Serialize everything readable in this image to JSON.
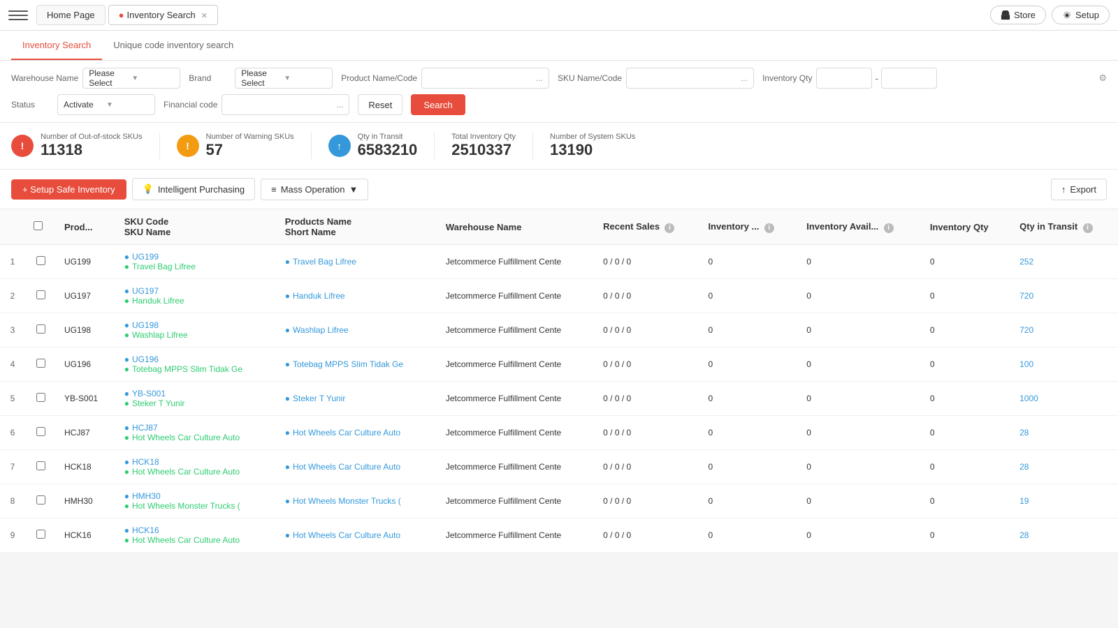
{
  "topNav": {
    "homeTab": "Home Page",
    "inventoryTab": "Inventory Search",
    "storeBtn": "Store",
    "setupBtn": "Setup"
  },
  "pageTabs": [
    {
      "id": "inventory-search",
      "label": "Inventory Search",
      "active": true
    },
    {
      "id": "unique-code",
      "label": "Unique code inventory search",
      "active": false
    }
  ],
  "filters": {
    "warehouseLabel": "Warehouse Name",
    "warehousePlaceholder": "Please Select",
    "brandLabel": "Brand",
    "brandPlaceholder": "Please Select",
    "productNameLabel": "Product Name/Code",
    "skuLabel": "SKU Name/Code",
    "inventoryQtyLabel": "Inventory Qty",
    "statusLabel": "Status",
    "statusValue": "Activate",
    "financialCodeLabel": "Financial code",
    "resetBtn": "Reset",
    "searchBtn": "Search"
  },
  "stats": [
    {
      "id": "out-of-stock",
      "iconText": "!",
      "iconClass": "red",
      "label": "Number of Out-of-stock SKUs",
      "value": "11318"
    },
    {
      "id": "warning-skus",
      "iconText": "!",
      "iconClass": "orange",
      "label": "Number of Warning SKUs",
      "value": "57"
    },
    {
      "id": "qty-transit",
      "iconText": "↑",
      "iconClass": "blue",
      "label": "Qty in Transit",
      "value": "6583210"
    },
    {
      "id": "total-inventory",
      "iconClass": "none",
      "label": "Total Inventory Qty",
      "value": "2510337"
    },
    {
      "id": "system-skus",
      "iconClass": "none",
      "label": "Number of System SKUs",
      "value": "13190"
    }
  ],
  "actions": {
    "setupSafe": "+ Setup Safe Inventory",
    "intelligentPurchasing": "Intelligent Purchasing",
    "massOperation": "Mass Operation",
    "export": "Export"
  },
  "tableColumns": [
    {
      "id": "checkbox",
      "label": ""
    },
    {
      "id": "prod-code",
      "label": "Prod..."
    },
    {
      "id": "sku-code-name",
      "label1": "SKU Code",
      "label2": "SKU Name"
    },
    {
      "id": "products-name",
      "label1": "Products Name",
      "label2": "Short Name"
    },
    {
      "id": "warehouse",
      "label": "Warehouse Name"
    },
    {
      "id": "recent-sales",
      "label": "Recent Sales",
      "info": true
    },
    {
      "id": "inventory",
      "label": "Inventory ...",
      "info": true
    },
    {
      "id": "inventory-avail",
      "label": "Inventory Avail...",
      "info": true
    },
    {
      "id": "inventory-qty",
      "label": "Inventory Qty"
    },
    {
      "id": "qty-transit",
      "label": "Qty in Transit",
      "info": true
    }
  ],
  "tableRows": [
    {
      "num": 1,
      "prod": "UG199",
      "skuCode": "UG199",
      "skuName": "Travel Bag Lifree",
      "prodName": "Travel Bag Lifree",
      "warehouse": "Jetcommerce Fulfillment Cente",
      "recentSales": "0 / 0 / 0",
      "inventory": "0",
      "inventoryAvail": "0",
      "inventoryQty": "0",
      "qtyTransit": "252"
    },
    {
      "num": 2,
      "prod": "UG197",
      "skuCode": "UG197",
      "skuName": "Handuk Lifree",
      "prodName": "Handuk Lifree",
      "warehouse": "Jetcommerce Fulfillment Cente",
      "recentSales": "0 / 0 / 0",
      "inventory": "0",
      "inventoryAvail": "0",
      "inventoryQty": "0",
      "qtyTransit": "720"
    },
    {
      "num": 3,
      "prod": "UG198",
      "skuCode": "UG198",
      "skuName": "Washlap Lifree",
      "prodName": "Washlap Lifree",
      "warehouse": "Jetcommerce Fulfillment Cente",
      "recentSales": "0 / 0 / 0",
      "inventory": "0",
      "inventoryAvail": "0",
      "inventoryQty": "0",
      "qtyTransit": "720"
    },
    {
      "num": 4,
      "prod": "UG196",
      "skuCode": "UG196",
      "skuName": "Totebag MPPS Slim Tidak Ge",
      "prodName": "Totebag MPPS Slim Tidak Ge",
      "warehouse": "Jetcommerce Fulfillment Cente",
      "recentSales": "0 / 0 / 0",
      "inventory": "0",
      "inventoryAvail": "0",
      "inventoryQty": "0",
      "qtyTransit": "100"
    },
    {
      "num": 5,
      "prod": "YB-S001",
      "skuCode": "YB-S001",
      "skuName": "Steker T Yunir",
      "prodName": "Steker T Yunir",
      "warehouse": "Jetcommerce Fulfillment Cente",
      "recentSales": "0 / 0 / 0",
      "inventory": "0",
      "inventoryAvail": "0",
      "inventoryQty": "0",
      "qtyTransit": "1000"
    },
    {
      "num": 6,
      "prod": "HCJ87",
      "skuCode": "HCJ87",
      "skuName": "Hot Wheels Car Culture Auto",
      "prodName": "Hot Wheels Car Culture Auto",
      "warehouse": "Jetcommerce Fulfillment Cente",
      "recentSales": "0 / 0 / 0",
      "inventory": "0",
      "inventoryAvail": "0",
      "inventoryQty": "0",
      "qtyTransit": "28"
    },
    {
      "num": 7,
      "prod": "HCK18",
      "skuCode": "HCK18",
      "skuName": "Hot Wheels Car Culture Auto",
      "prodName": "Hot Wheels Car Culture Auto",
      "warehouse": "Jetcommerce Fulfillment Cente",
      "recentSales": "0 / 0 / 0",
      "inventory": "0",
      "inventoryAvail": "0",
      "inventoryQty": "0",
      "qtyTransit": "28"
    },
    {
      "num": 8,
      "prod": "HMH30",
      "skuCode": "HMH30",
      "skuName": "Hot Wheels Monster Trucks (",
      "prodName": "Hot Wheels Monster Trucks (",
      "warehouse": "Jetcommerce Fulfillment Cente",
      "recentSales": "0 / 0 / 0",
      "inventory": "0",
      "inventoryAvail": "0",
      "inventoryQty": "0",
      "qtyTransit": "19"
    },
    {
      "num": 9,
      "prod": "HCK16",
      "skuCode": "HCK16",
      "skuName": "Hot Wheels Car Culture Auto",
      "prodName": "Hot Wheels Car Culture Auto",
      "warehouse": "Jetcommerce Fulfillment Cente",
      "recentSales": "0 / 0 / 0",
      "inventory": "0",
      "inventoryAvail": "0",
      "inventoryQty": "0",
      "qtyTransit": "28"
    }
  ]
}
